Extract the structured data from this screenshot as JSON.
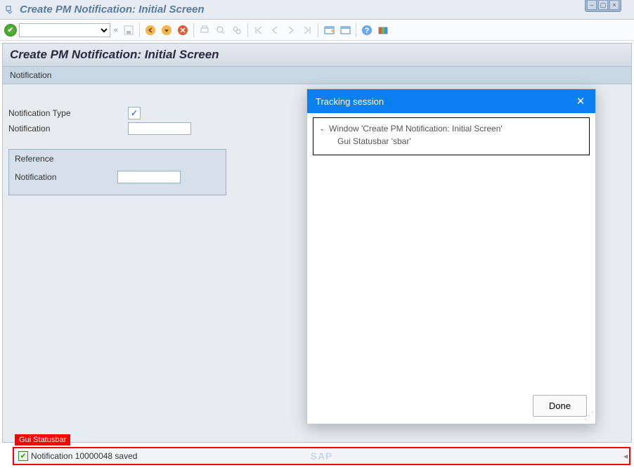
{
  "window": {
    "title": "Create PM Notification: Initial Screen"
  },
  "page": {
    "heading": "Create PM Notification: Initial Screen",
    "subheading": "Notification"
  },
  "form": {
    "notification_type_label": "Notification Type",
    "notification_label": "Notification",
    "notification_value": ""
  },
  "reference": {
    "legend": "Reference",
    "notification_label": "Notification",
    "notification_value": ""
  },
  "popup": {
    "title": "Tracking session",
    "tree": {
      "window_label": "Window 'Create PM Notification: Initial Screen'",
      "child_label": "Gui Statusbar 'sbar'"
    },
    "done_label": "Done"
  },
  "statusbar": {
    "tag": "Gui Statusbar",
    "message": "Notification 10000048 saved",
    "logo_text": "SAP"
  },
  "icons": {
    "expand_all": "«"
  }
}
